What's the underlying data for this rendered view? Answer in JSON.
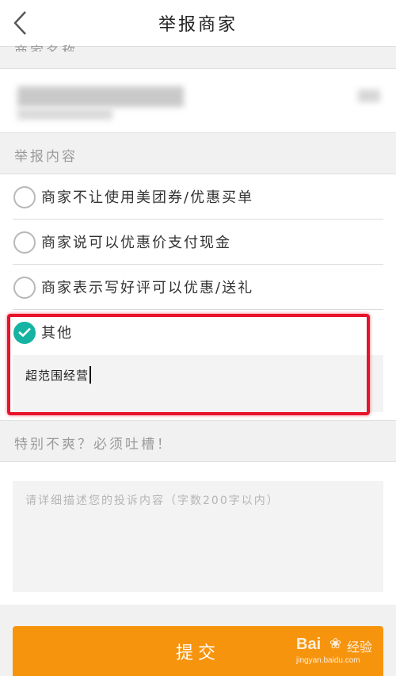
{
  "header": {
    "title": "举报商家"
  },
  "merchant_section": {
    "label": "商家名称"
  },
  "report_section": {
    "label": "举报内容",
    "options": [
      {
        "label": "商家不让使用美团券/优惠买单",
        "checked": false
      },
      {
        "label": "商家说可以优惠价支付现金",
        "checked": false
      },
      {
        "label": "商家表示写好评可以优惠/送礼",
        "checked": false
      },
      {
        "label": "其他",
        "checked": true
      }
    ],
    "other_value": "超范围经营"
  },
  "complaint_section": {
    "label": "特别不爽？必须吐槽！",
    "placeholder": "请详细描述您的投诉内容（字数200字以内）"
  },
  "submit": {
    "label": "提交"
  },
  "watermark": {
    "logo": "Bai",
    "brand": "经验",
    "url": "jingyan.baidu.com"
  },
  "colors": {
    "accent": "#f7940d",
    "check": "#16b3a2",
    "highlight": "#e8132b"
  }
}
